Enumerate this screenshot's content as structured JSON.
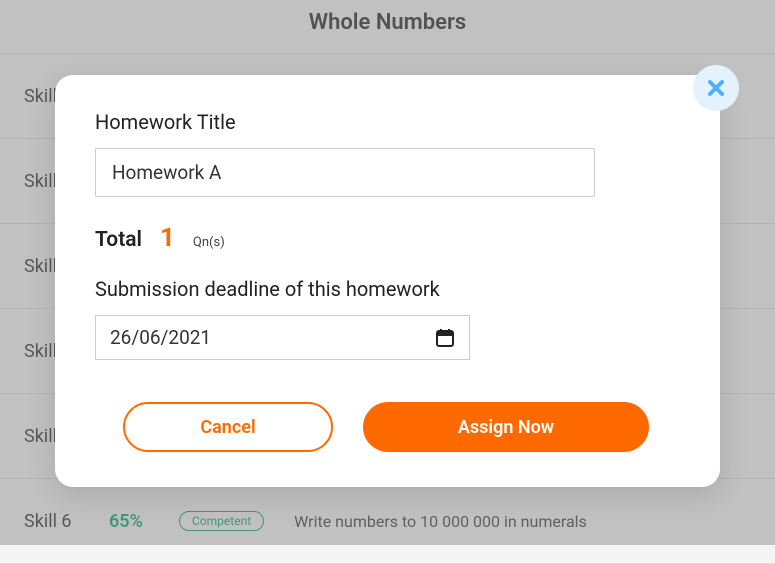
{
  "background": {
    "title": "Whole Numbers",
    "skills": [
      {
        "label": "Skill"
      },
      {
        "label": "Skill"
      },
      {
        "label": "Skill"
      },
      {
        "label": "Skill"
      },
      {
        "label": "Skill"
      },
      {
        "label": "Skill 6",
        "percent": "65%",
        "badge": "Competent",
        "desc": "Write numbers to 10 000 000 in numerals"
      }
    ]
  },
  "modal": {
    "title_label": "Homework Title",
    "title_value": "Homework A",
    "total_label": "Total",
    "total_count": "1",
    "total_unit": "Qn(s)",
    "deadline_label": "Submission deadline of this homework",
    "deadline_value": "26/06/2021",
    "cancel_label": "Cancel",
    "assign_label": "Assign Now"
  }
}
